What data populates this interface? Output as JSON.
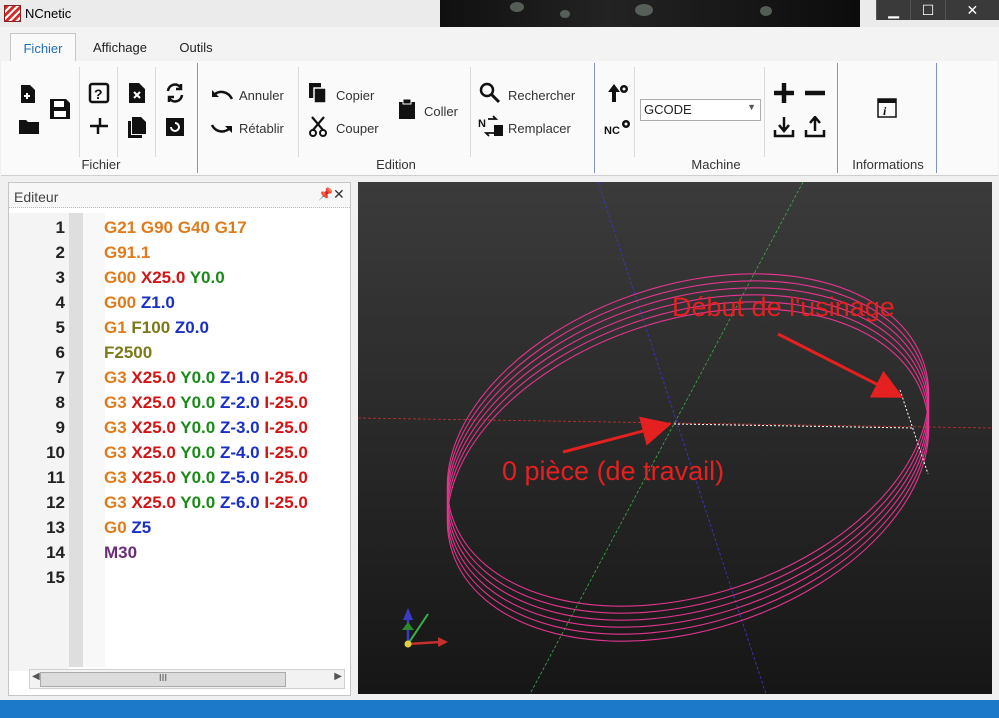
{
  "window": {
    "title": "NCnetic",
    "controls": [
      "▁",
      "☐",
      "✕"
    ]
  },
  "tabs": [
    "Fichier",
    "Affichage",
    "Outils"
  ],
  "ribbon": {
    "groups": {
      "fichier": "Fichier",
      "edition": "Edition",
      "machine": "Machine",
      "informations": "Informations"
    },
    "edition": {
      "undo": "Annuler",
      "redo": "Rétablir",
      "copy": "Copier",
      "cut": "Couper",
      "paste": "Coller",
      "search": "Rechercher",
      "replace": "Remplacer"
    },
    "machine": {
      "select_value": "GCODE"
    }
  },
  "editor": {
    "title": "Editeur",
    "lines": [
      {
        "n": "1",
        "tokens": [
          {
            "t": "G21 ",
            "c": "#e07b1c"
          },
          {
            "t": "G90 ",
            "c": "#e07b1c"
          },
          {
            "t": "G40 ",
            "c": "#e07b1c"
          },
          {
            "t": "G17",
            "c": "#e07b1c"
          }
        ]
      },
      {
        "n": "2",
        "tokens": [
          {
            "t": "G91.1",
            "c": "#e07b1c"
          }
        ]
      },
      {
        "n": "3",
        "tokens": [
          {
            "t": "G00 ",
            "c": "#e07b1c"
          },
          {
            "t": "X25.0 ",
            "c": "#d41414"
          },
          {
            "t": "Y0.0",
            "c": "#1a8a1a"
          }
        ]
      },
      {
        "n": "4",
        "tokens": [
          {
            "t": "G00 ",
            "c": "#e07b1c"
          },
          {
            "t": "Z1.0",
            "c": "#1a2fc4"
          }
        ]
      },
      {
        "n": "5",
        "tokens": [
          {
            "t": "G1 ",
            "c": "#e07b1c"
          },
          {
            "t": "F100 ",
            "c": "#7a7a1a"
          },
          {
            "t": "Z0.0",
            "c": "#1a2fc4"
          }
        ]
      },
      {
        "n": "6",
        "tokens": [
          {
            "t": "F2500",
            "c": "#7a7a1a"
          }
        ]
      },
      {
        "n": "7",
        "tokens": [
          {
            "t": "G3 ",
            "c": "#e07b1c"
          },
          {
            "t": "X25.0 ",
            "c": "#d41414"
          },
          {
            "t": "Y0.0 ",
            "c": "#1a8a1a"
          },
          {
            "t": "Z-1.0 ",
            "c": "#1a2fc4"
          },
          {
            "t": "I-25.0 ",
            "c": "#d41414"
          }
        ]
      },
      {
        "n": "8",
        "tokens": [
          {
            "t": "G3 ",
            "c": "#e07b1c"
          },
          {
            "t": "X25.0 ",
            "c": "#d41414"
          },
          {
            "t": "Y0.0 ",
            "c": "#1a8a1a"
          },
          {
            "t": "Z-2.0 ",
            "c": "#1a2fc4"
          },
          {
            "t": "I-25.0 ",
            "c": "#d41414"
          }
        ]
      },
      {
        "n": "9",
        "tokens": [
          {
            "t": "G3 ",
            "c": "#e07b1c"
          },
          {
            "t": "X25.0 ",
            "c": "#d41414"
          },
          {
            "t": "Y0.0 ",
            "c": "#1a8a1a"
          },
          {
            "t": "Z-3.0 ",
            "c": "#1a2fc4"
          },
          {
            "t": "I-25.0 ",
            "c": "#d41414"
          }
        ]
      },
      {
        "n": "10",
        "tokens": [
          {
            "t": "G3 ",
            "c": "#e07b1c"
          },
          {
            "t": "X25.0 ",
            "c": "#d41414"
          },
          {
            "t": "Y0.0 ",
            "c": "#1a8a1a"
          },
          {
            "t": "Z-4.0 ",
            "c": "#1a2fc4"
          },
          {
            "t": "I-25.0 ",
            "c": "#d41414"
          }
        ]
      },
      {
        "n": "11",
        "tokens": [
          {
            "t": "G3 ",
            "c": "#e07b1c"
          },
          {
            "t": "X25.0 ",
            "c": "#d41414"
          },
          {
            "t": "Y0.0 ",
            "c": "#1a8a1a"
          },
          {
            "t": "Z-5.0 ",
            "c": "#1a2fc4"
          },
          {
            "t": "I-25.0 ",
            "c": "#d41414"
          }
        ]
      },
      {
        "n": "12",
        "tokens": [
          {
            "t": "G3 ",
            "c": "#e07b1c"
          },
          {
            "t": "X25.0 ",
            "c": "#d41414"
          },
          {
            "t": "Y0.0 ",
            "c": "#1a8a1a"
          },
          {
            "t": "Z-6.0 ",
            "c": "#1a2fc4"
          },
          {
            "t": "I-25.0 ",
            "c": "#d41414"
          }
        ]
      },
      {
        "n": "13",
        "tokens": [
          {
            "t": "G0 ",
            "c": "#e07b1c"
          },
          {
            "t": "Z5",
            "c": "#1a2fc4"
          }
        ]
      },
      {
        "n": "14",
        "tokens": [
          {
            "t": "M30",
            "c": "#6b2c7a"
          }
        ]
      },
      {
        "n": "15",
        "tokens": []
      }
    ],
    "scroll_thumb": "III"
  },
  "viewport": {
    "annotations": {
      "start": "Début de l'usinage",
      "origin": "0 pièce (de travail)"
    },
    "colors": {
      "toolpath": "#e3358f",
      "annotation": "#e52020",
      "axis_x": "#c43030",
      "axis_y": "#3ab04a",
      "axis_z": "#3a3ac8"
    }
  }
}
